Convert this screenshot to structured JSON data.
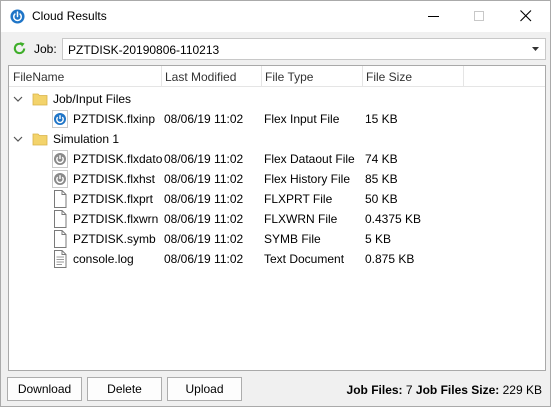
{
  "window": {
    "title": "Cloud Results"
  },
  "job": {
    "label": "Job:",
    "selected": "PZTDISK-20190806-110213"
  },
  "columns": [
    "FileName",
    "Last Modified",
    "File Type",
    "File Size"
  ],
  "groups": [
    {
      "name": "Job/Input Files",
      "expanded": true,
      "files": [
        {
          "name": "PZTDISK.flxinp",
          "modified": "08/06/19 11:02",
          "type": "Flex Input File",
          "size": "15 KB",
          "icon": "flex-blue-icon"
        }
      ]
    },
    {
      "name": "Simulation 1",
      "expanded": true,
      "files": [
        {
          "name": "PZTDISK.flxdato",
          "modified": "08/06/19 11:02",
          "type": "Flex Dataout File",
          "size": "74 KB",
          "icon": "flex-gray-icon"
        },
        {
          "name": "PZTDISK.flxhst",
          "modified": "08/06/19 11:02",
          "type": "Flex History File",
          "size": "85 KB",
          "icon": "flex-gray-icon"
        },
        {
          "name": "PZTDISK.flxprt",
          "modified": "08/06/19 11:02",
          "type": "FLXPRT File",
          "size": "50 KB",
          "icon": "document-icon"
        },
        {
          "name": "PZTDISK.flxwrn",
          "modified": "08/06/19 11:02",
          "type": "FLXWRN File",
          "size": "0.4375 KB",
          "icon": "document-icon"
        },
        {
          "name": "PZTDISK.symb",
          "modified": "08/06/19 11:02",
          "type": "SYMB File",
          "size": "5 KB",
          "icon": "document-icon"
        },
        {
          "name": "console.log",
          "modified": "08/06/19 11:02",
          "type": "Text Document",
          "size": "0.875 KB",
          "icon": "text-document-icon"
        }
      ]
    }
  ],
  "buttons": {
    "download": "Download",
    "delete": "Delete",
    "upload": "Upload"
  },
  "status": {
    "job_files_label": "Job Files:",
    "job_files_count": "7",
    "job_files_size_label": "Job Files Size:",
    "job_files_size": "229 KB"
  },
  "colors": {
    "accent": "#1f75c7",
    "folder": "#f3d36b",
    "refresh": "#3fae2a"
  }
}
